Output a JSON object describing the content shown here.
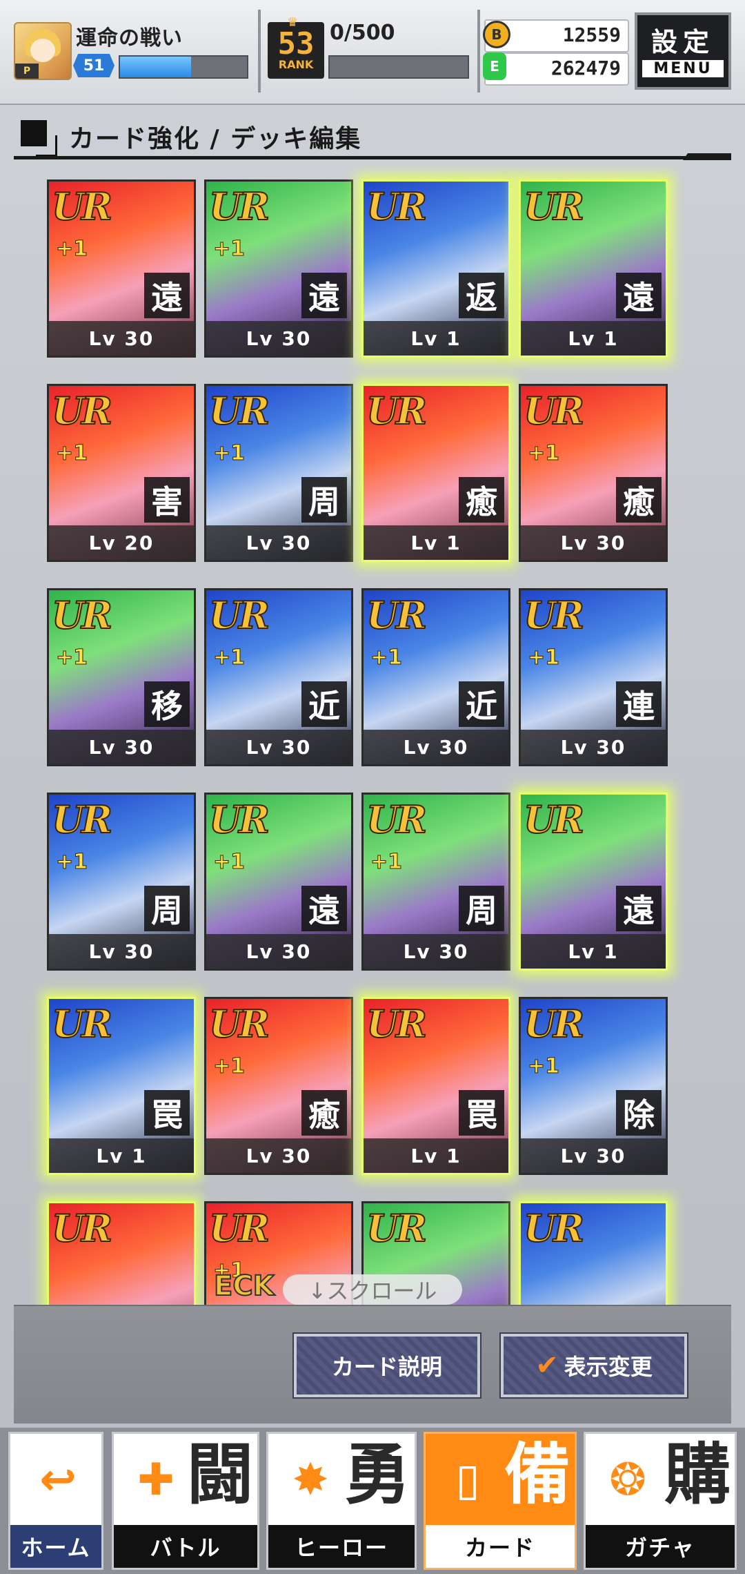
{
  "header": {
    "player_name": "運命の戦い",
    "avatar_badge": "P",
    "level": "51",
    "level_progress": 0.56,
    "rank_number": "53",
    "rank_label": "RANK",
    "rank_count": "0/500",
    "coin_icon": "B",
    "coin_value": "12559",
    "energy_icon": "E",
    "energy_value": "262479",
    "menu_big": "設定",
    "menu_small": "MENU"
  },
  "section": {
    "title": "カード強化 / デッキ編集"
  },
  "cards": [
    {
      "rarity": "UR",
      "plus": "+1",
      "type": "遠",
      "level": "Lv 30",
      "bg": "red",
      "glow": false
    },
    {
      "rarity": "UR",
      "plus": "+1",
      "type": "遠",
      "level": "Lv 30",
      "bg": "green",
      "glow": false
    },
    {
      "rarity": "UR",
      "plus": "",
      "type": "返",
      "level": "Lv 1",
      "bg": "blue",
      "glow": true
    },
    {
      "rarity": "UR",
      "plus": "",
      "type": "遠",
      "level": "Lv 1",
      "bg": "green",
      "glow": true
    },
    {
      "rarity": "UR",
      "plus": "+1",
      "type": "害",
      "level": "Lv 20",
      "bg": "red",
      "glow": false
    },
    {
      "rarity": "UR",
      "plus": "+1",
      "type": "周",
      "level": "Lv 30",
      "bg": "blue",
      "glow": false
    },
    {
      "rarity": "UR",
      "plus": "",
      "type": "癒",
      "level": "Lv 1",
      "bg": "red",
      "glow": true
    },
    {
      "rarity": "UR",
      "plus": "+1",
      "type": "癒",
      "level": "Lv 30",
      "bg": "red",
      "glow": false
    },
    {
      "rarity": "UR",
      "plus": "+1",
      "type": "移",
      "level": "Lv 30",
      "bg": "green",
      "glow": false
    },
    {
      "rarity": "UR",
      "plus": "+1",
      "type": "近",
      "level": "Lv 30",
      "bg": "blue",
      "glow": false
    },
    {
      "rarity": "UR",
      "plus": "+1",
      "type": "近",
      "level": "Lv 30",
      "bg": "blue",
      "glow": false
    },
    {
      "rarity": "UR",
      "plus": "+1",
      "type": "連",
      "level": "Lv 30",
      "bg": "blue",
      "glow": false
    },
    {
      "rarity": "UR",
      "plus": "+1",
      "type": "周",
      "level": "Lv 30",
      "bg": "blue",
      "glow": false
    },
    {
      "rarity": "UR",
      "plus": "+1",
      "type": "遠",
      "level": "Lv 30",
      "bg": "green",
      "glow": false
    },
    {
      "rarity": "UR",
      "plus": "+1",
      "type": "周",
      "level": "Lv 30",
      "bg": "green",
      "glow": false
    },
    {
      "rarity": "UR",
      "plus": "",
      "type": "遠",
      "level": "Lv 1",
      "bg": "green",
      "glow": true
    },
    {
      "rarity": "UR",
      "plus": "",
      "type": "罠",
      "level": "Lv 1",
      "bg": "blue",
      "glow": true
    },
    {
      "rarity": "UR",
      "plus": "+1",
      "type": "癒",
      "level": "Lv 30",
      "bg": "red",
      "glow": false
    },
    {
      "rarity": "UR",
      "plus": "",
      "type": "罠",
      "level": "Lv 1",
      "bg": "red",
      "glow": true
    },
    {
      "rarity": "UR",
      "plus": "+1",
      "type": "除",
      "level": "Lv 30",
      "bg": "blue",
      "glow": false
    },
    {
      "rarity": "UR",
      "plus": "",
      "type": "",
      "level": "",
      "bg": "red",
      "glow": true
    },
    {
      "rarity": "UR",
      "plus": "+1",
      "type": "",
      "level": "",
      "bg": "red",
      "glow": false
    },
    {
      "rarity": "UR",
      "plus": "",
      "type": "",
      "level": "",
      "bg": "green",
      "glow": false
    },
    {
      "rarity": "UR",
      "plus": "",
      "type": "",
      "level": "",
      "bg": "blue",
      "glow": true
    }
  ],
  "overlay": {
    "deck_text": "ECK",
    "scroll_hint": "↓スクロール"
  },
  "actions": {
    "card_desc": "カード説明",
    "display_change": "表示変更"
  },
  "nav": [
    {
      "label": "ホーム",
      "kanji": "",
      "icon": "back-arrow-icon",
      "glyph": "↩"
    },
    {
      "label": "バトル",
      "kanji": "闘",
      "icon": "gamepad-icon",
      "glyph": "✚"
    },
    {
      "label": "ヒーロー",
      "kanji": "勇",
      "icon": "hero-icon",
      "glyph": "✸"
    },
    {
      "label": "カード",
      "kanji": "備",
      "icon": "cards-icon",
      "glyph": "▯"
    },
    {
      "label": "ガチャ",
      "kanji": "購",
      "icon": "gacha-icon",
      "glyph": "❂"
    }
  ],
  "colors": {
    "accent": "#ff8a14",
    "ur_gold": "#f6c23a",
    "glow": "#e6ff6a",
    "button": "#4b4f75"
  }
}
